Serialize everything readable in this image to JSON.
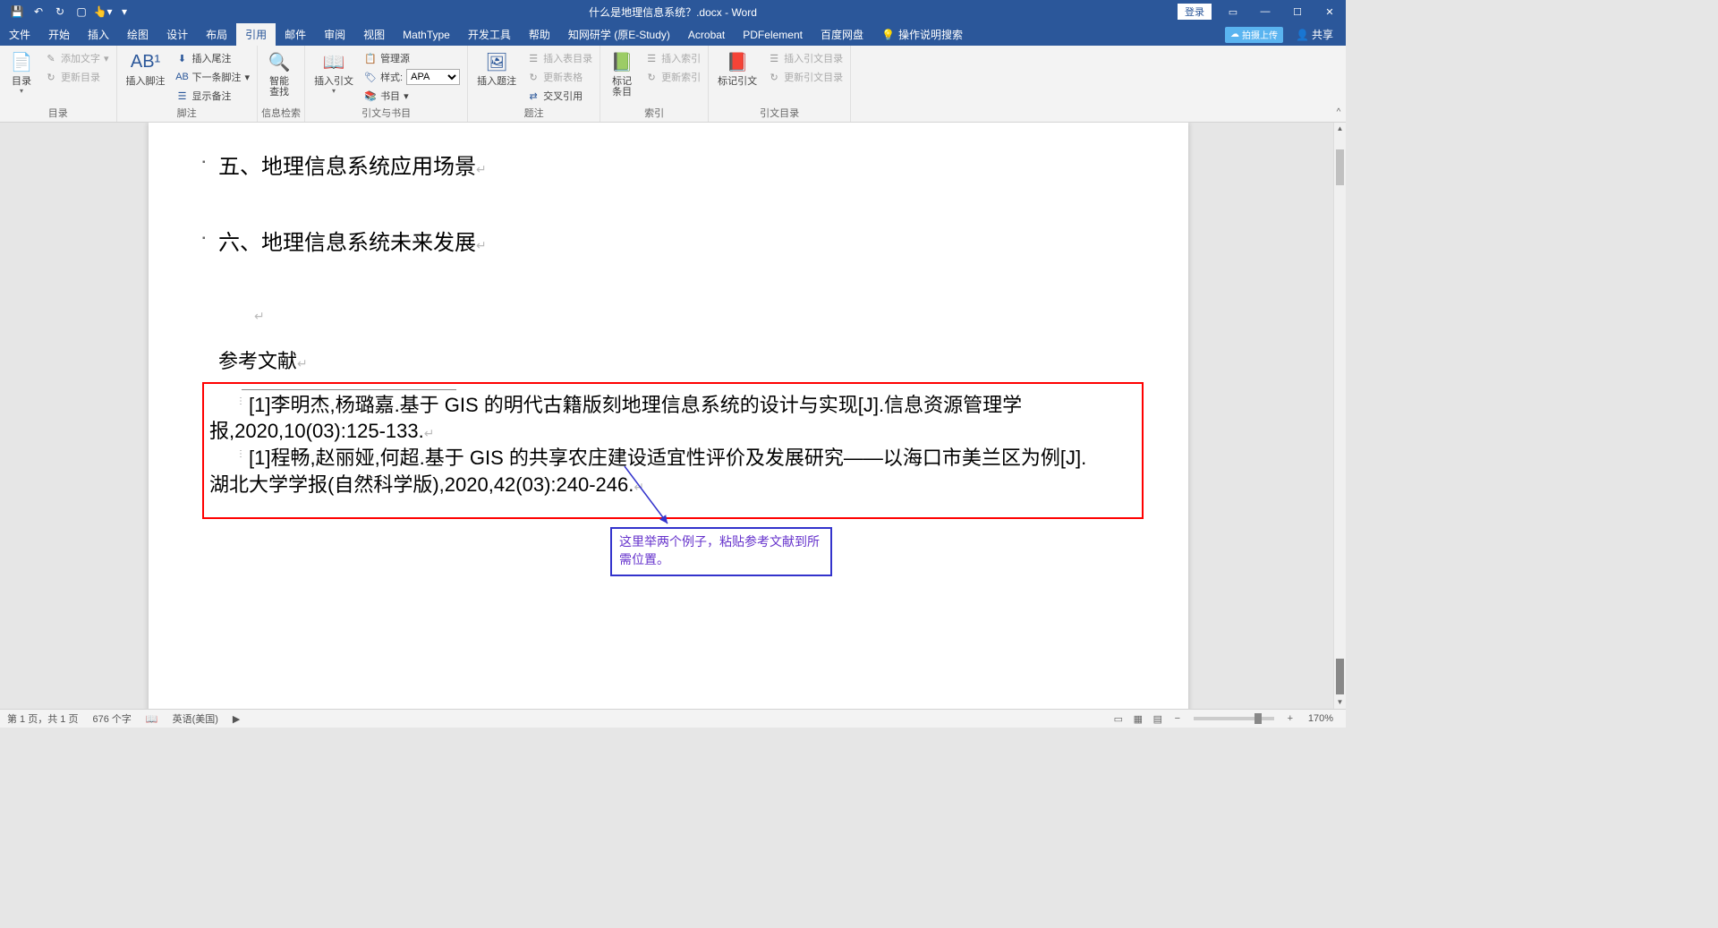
{
  "title": "什么是地理信息系统？.docx - Word",
  "login": "登录",
  "share": "共享",
  "baidu_upload": "拍摄上传",
  "tabs": [
    "文件",
    "开始",
    "插入",
    "绘图",
    "设计",
    "布局",
    "引用",
    "邮件",
    "审阅",
    "视图",
    "MathType",
    "开发工具",
    "帮助",
    "知网研学 (原E-Study)",
    "Acrobat",
    "PDFelement",
    "百度网盘"
  ],
  "tell_me": "操作说明搜索",
  "ribbon": {
    "g1": {
      "label": "目录",
      "toc": "目录",
      "add_text": "添加文字",
      "update": "更新目录"
    },
    "g2": {
      "label": "脚注",
      "insert_fn": "插入脚注",
      "insert_en": "插入尾注",
      "next_fn": "下一条脚注",
      "show_notes": "显示备注"
    },
    "g3": {
      "label": "信息检索",
      "smart": "智能\n查找"
    },
    "g4": {
      "label": "引文与书目",
      "insert_cit": "插入引文",
      "manage": "管理源",
      "style": "样式:",
      "style_val": "APA",
      "biblio": "书目"
    },
    "g5": {
      "label": "题注",
      "insert_cap": "插入题注",
      "insert_tof": "插入表目录",
      "update_tof": "更新表格",
      "crossref": "交叉引用"
    },
    "g6": {
      "label": "索引",
      "mark_entry": "标记\n条目",
      "insert_idx": "插入索引",
      "update_idx": "更新索引"
    },
    "g7": {
      "label": "引文目录",
      "mark_cit": "标记引文",
      "insert_toa": "插入引文目录",
      "update_toa": "更新引文目录"
    }
  },
  "doc": {
    "h5": "五、地理信息系统应用场景",
    "h6": "六、地理信息系统未来发展",
    "ref_title": "参考文献",
    "ref1_a": "[1]李明杰,杨璐嘉.基于 GIS 的明代古籍版刻地理信息系统的设计与实现[J].信息资源管理学",
    "ref1_b": "报,2020,10(03):125-133.",
    "ref2_a": "[1]程畅,赵丽娅,何超.基于 GIS 的共享农庄建设适宜性评价及发展研究——以海口市美兰区为例[J].",
    "ref2_b": "湖北大学学报(自然科学版),2020,42(03):240-246.",
    "callout": "这里举两个例子，粘贴参考文献到所需位置。"
  },
  "status": {
    "page": "第 1 页，共 1 页",
    "words": "676 个字",
    "lang": "英语(美国)",
    "zoom": "170%"
  }
}
